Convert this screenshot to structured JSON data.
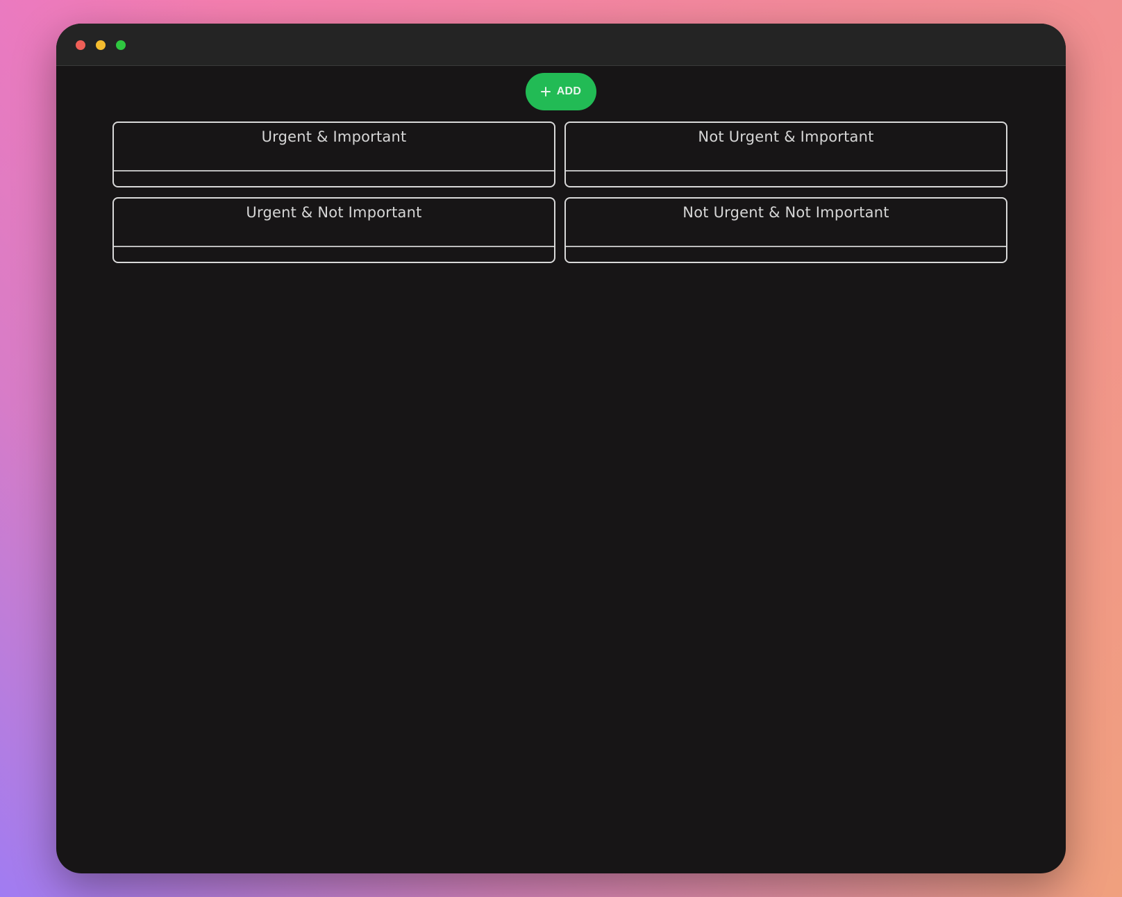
{
  "toolbar": {
    "add_label": "ADD",
    "add_icon": "plus-icon",
    "add_color": "#22bb55"
  },
  "window_controls": {
    "close_color": "#ef5f57",
    "minimize_color": "#f5bd2f",
    "maximize_color": "#2fc740"
  },
  "quadrants": [
    {
      "title": "Urgent & Important"
    },
    {
      "title": "Not Urgent & Important"
    },
    {
      "title": "Urgent & Not Important"
    },
    {
      "title": "Not Urgent & Not Important"
    }
  ]
}
